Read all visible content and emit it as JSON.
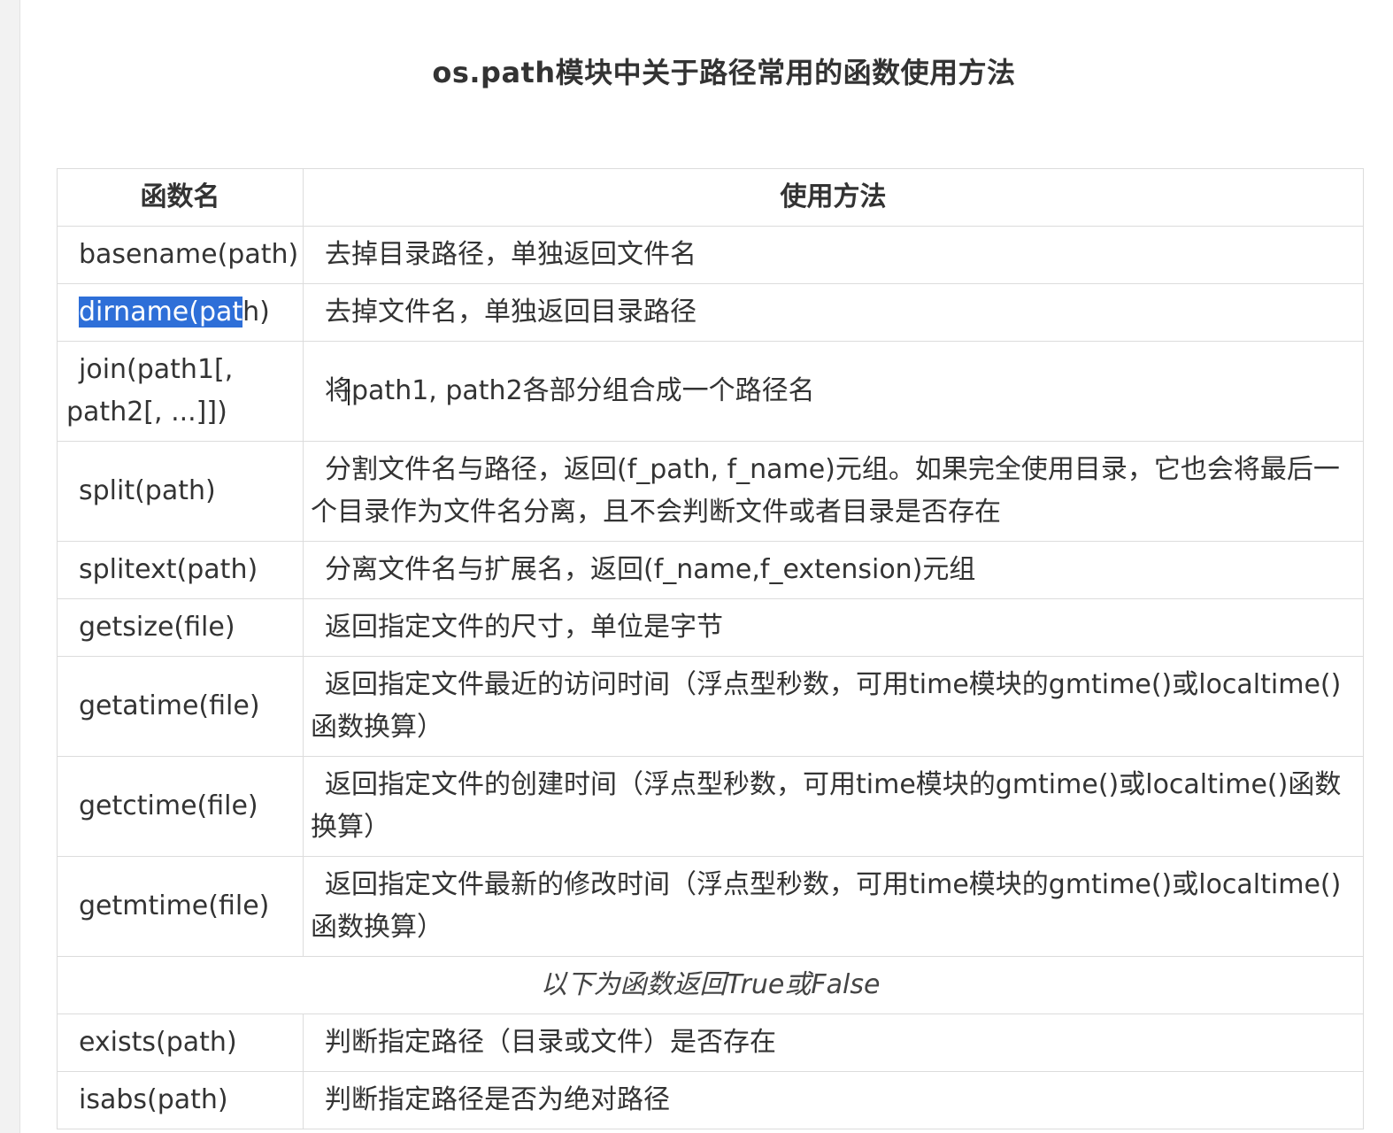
{
  "title": "os.path模块中关于路径常用的函数使用方法",
  "colors": {
    "selection": "#2e6fd8",
    "border": "#dcdcdc",
    "text": "#333333"
  },
  "table": {
    "headers": [
      "函数名",
      "使用方法"
    ],
    "rows": [
      {
        "name": "basename(path)",
        "desc": "去掉目录路径，单独返回文件名"
      },
      {
        "name_selected": "dirname(pat",
        "name_rest": "h)",
        "desc": "去掉文件名，单独返回目录路径"
      },
      {
        "name": "join(path1[, path2[, ...]])",
        "desc_prefix": "将",
        "desc_rest": "path1, path2各部分组合成一个路径名"
      },
      {
        "name": "split(path)",
        "desc": "分割文件名与路径，返回(f_path, f_name)元组。如果完全使用目录，它也会将最后一个目录作为文件名分离，且不会判断文件或者目录是否存在"
      },
      {
        "name": "splitext(path)",
        "desc": "分离文件名与扩展名，返回(f_name,f_extension)元组"
      },
      {
        "name": "getsize(file)",
        "desc": "返回指定文件的尺寸，单位是字节"
      },
      {
        "name": "getatime(file)",
        "desc": "返回指定文件最近的访问时间（浮点型秒数，可用time模块的gmtime()或localtime()函数换算）"
      },
      {
        "name": "getctime(file)",
        "desc": "返回指定文件的创建时间（浮点型秒数，可用time模块的gmtime()或localtime()函数换算）"
      },
      {
        "name": "getmtime(file)",
        "desc": "返回指定文件最新的修改时间（浮点型秒数，可用time模块的gmtime()或localtime()函数换算）"
      },
      {
        "name": "exists(path)",
        "desc": "判断指定路径（目录或文件）是否存在"
      },
      {
        "name": "isabs(path)",
        "desc": "判断指定路径是否为绝对路径"
      }
    ],
    "separator": "以下为函数返回True或False"
  }
}
